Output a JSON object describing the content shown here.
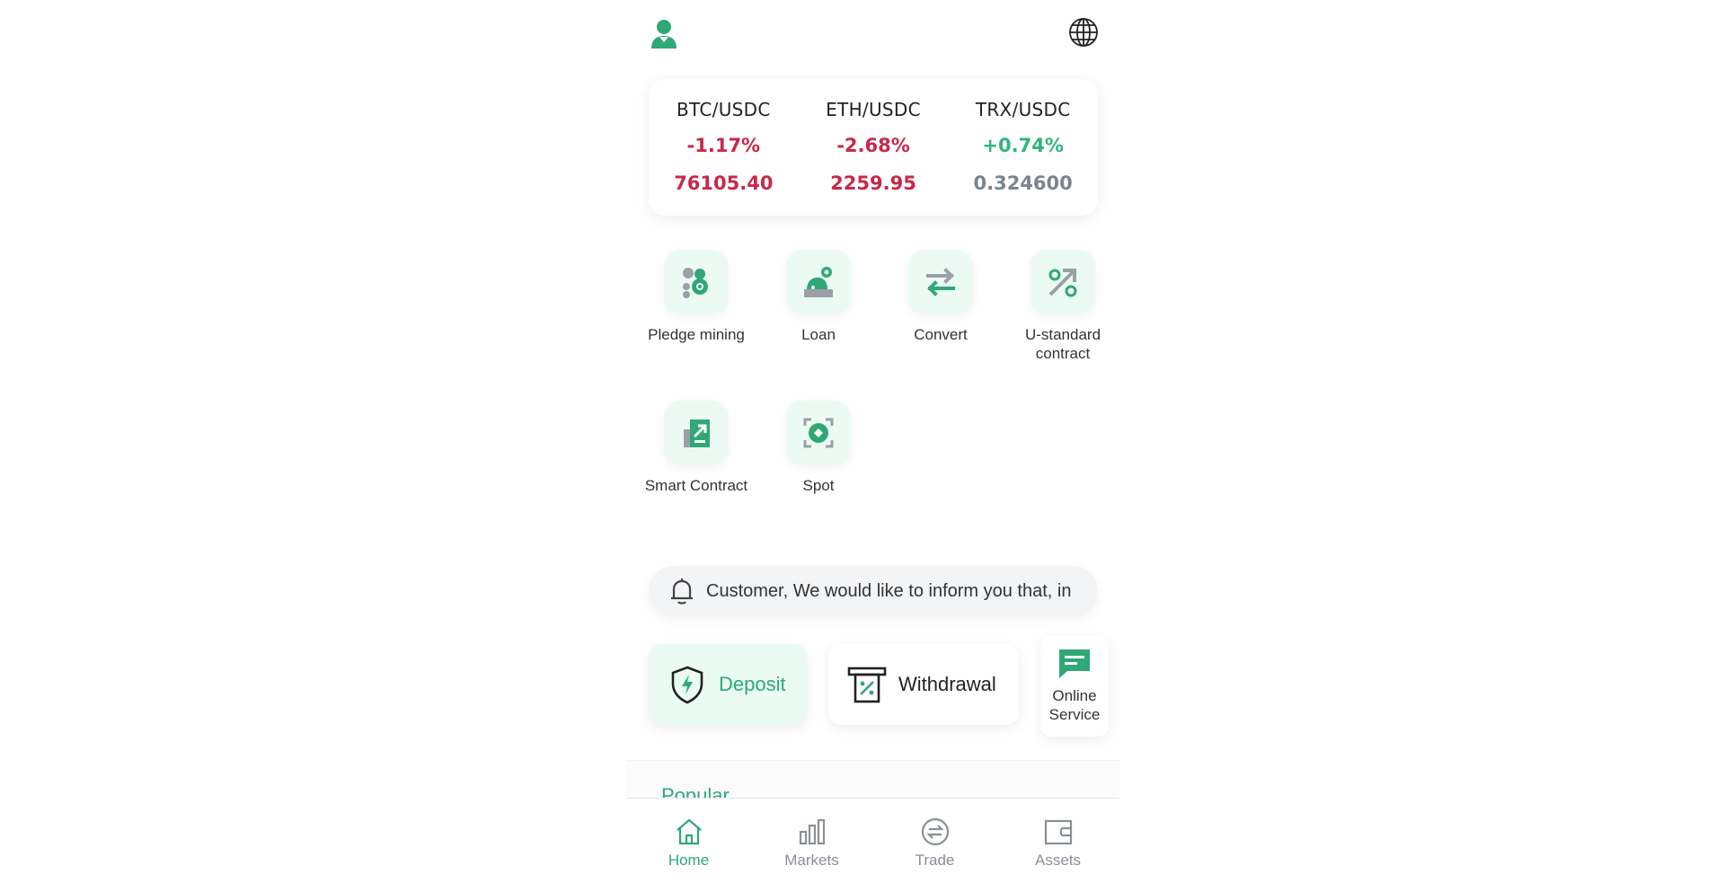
{
  "header": {
    "user_icon": "user-icon",
    "language_icon": "globe-icon"
  },
  "tickers": [
    {
      "pair": "BTC/USDC",
      "change": "-1.17%",
      "price": "76105.40",
      "trend": "down"
    },
    {
      "pair": "ETH/USDC",
      "change": "-2.68%",
      "price": "2259.95",
      "trend": "down"
    },
    {
      "pair": "TRX/USDC",
      "change": "+0.74%",
      "price": "0.324600",
      "trend": "up"
    }
  ],
  "quick_actions": [
    {
      "label": "Pledge mining",
      "icon": "pledge-mining-icon"
    },
    {
      "label": "Loan",
      "icon": "loan-icon"
    },
    {
      "label": "Convert",
      "icon": "convert-icon"
    },
    {
      "label": "U-standard contract",
      "icon": "u-standard-contract-icon"
    },
    {
      "label": "Smart Contract",
      "icon": "smart-contract-icon"
    },
    {
      "label": "Spot",
      "icon": "spot-icon"
    }
  ],
  "notice": {
    "text": "Customer, We would like to inform you that, in",
    "icon": "bell-icon"
  },
  "actions": {
    "deposit_label": "Deposit",
    "withdrawal_label": "Withdrawal",
    "service_label": "Online Service"
  },
  "popular": {
    "title": "Popular"
  },
  "bottom_nav": [
    {
      "label": "Home",
      "icon": "home-icon",
      "active": true
    },
    {
      "label": "Markets",
      "icon": "markets-icon",
      "active": false
    },
    {
      "label": "Trade",
      "icon": "trade-icon",
      "active": false
    },
    {
      "label": "Assets",
      "icon": "wallet-icon",
      "active": false
    }
  ],
  "colors": {
    "accent": "#2fa876",
    "down": "#c8284a",
    "up": "#2fb57d",
    "neutral": "#7a8390"
  }
}
